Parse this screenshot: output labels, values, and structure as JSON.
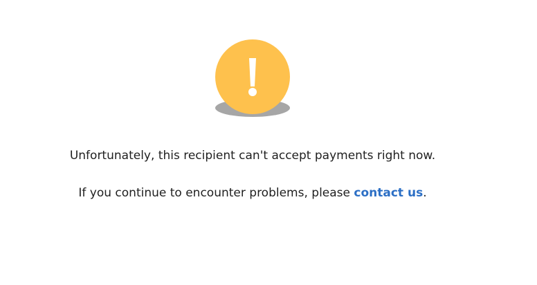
{
  "icon": {
    "name": "exclamation-icon",
    "circle_color": "#fec14d",
    "shadow_color": "#a6a6a6",
    "glyph_color": "#ffffff"
  },
  "messages": {
    "unavailable": "Unfortunately, this recipient can't accept payments right now.",
    "problems_prefix": "If you continue to encounter problems, please ",
    "contact_link": "contact us",
    "problems_suffix": "."
  },
  "colors": {
    "link": "#2c6fc5",
    "text": "#1f1f1f"
  }
}
